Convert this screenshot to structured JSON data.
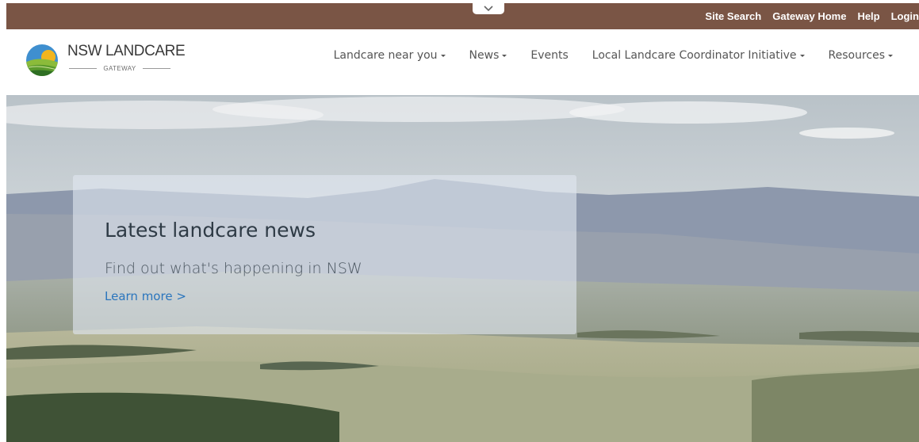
{
  "utility_bar": {
    "links": [
      "Site Search",
      "Gateway Home",
      "Help",
      "Login"
    ]
  },
  "logo": {
    "title": "NSW LANDCARE",
    "subtitle": "GATEWAY"
  },
  "nav": {
    "items": [
      {
        "label": "Landcare near you",
        "dropdown": true
      },
      {
        "label": "News",
        "dropdown": true
      },
      {
        "label": "Events",
        "dropdown": false
      },
      {
        "label": "Local Landcare Coordinator Initiative",
        "dropdown": true
      },
      {
        "label": "Resources",
        "dropdown": true
      }
    ]
  },
  "hero": {
    "title": "Latest landcare news",
    "subtitle": "Find out what's happening in NSW",
    "link": "Learn more >"
  },
  "colors": {
    "utility_bar": "#7a5545",
    "link": "#2a75bd",
    "nav_text": "#555555"
  },
  "icons": {
    "collapse": "chevron-down-icon",
    "logo": "landcare-logo-icon",
    "nav_dropdown": "caret-down-icon"
  }
}
